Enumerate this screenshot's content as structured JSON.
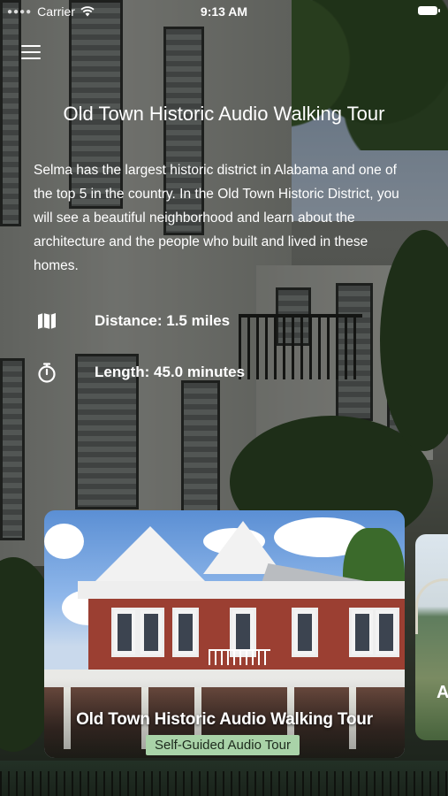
{
  "status_bar": {
    "carrier": "Carrier",
    "time": "9:13 AM"
  },
  "header": {
    "menu_icon": "hamburger-menu-icon",
    "title": "Old Town Historic Audio Walking Tour"
  },
  "description": "Selma has the largest historic district in Alabama and one of the top 5 in the country. In the Old Town Historic District, you will see a beautiful neighborhood and learn about the architecture and the people who built and lived in these homes.",
  "details": {
    "distance": {
      "icon": "map-icon",
      "label": "Distance: 1.5 miles"
    },
    "length": {
      "icon": "stopwatch-icon",
      "label": "Length: 45.0 minutes"
    }
  },
  "cards": [
    {
      "title": "Old Town Historic Audio Walking Tour",
      "badge": "Self-Guided Audio Tour"
    },
    {
      "title": "A"
    }
  ]
}
